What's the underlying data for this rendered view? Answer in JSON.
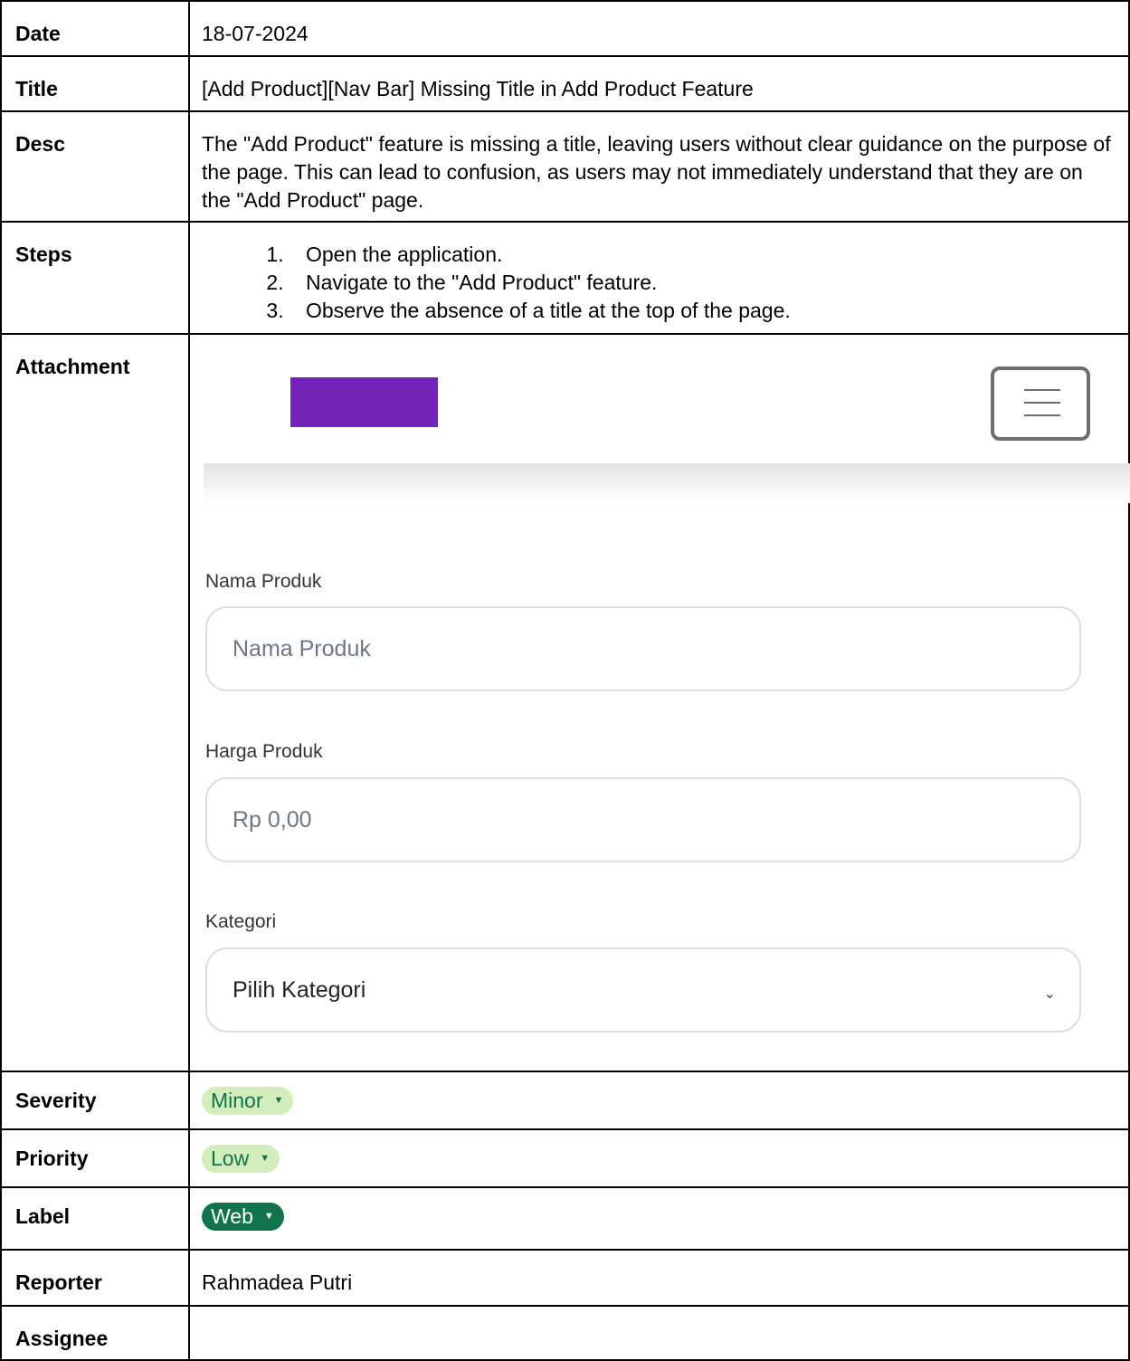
{
  "rows": {
    "date": {
      "label": "Date",
      "value": "18-07-2024"
    },
    "title": {
      "label": "Title",
      "value": "[Add Product][Nav Bar] Missing Title in Add Product Feature"
    },
    "desc": {
      "label": "Desc",
      "value": "The \"Add Product\" feature is missing a title, leaving users without clear guidance on the purpose of the page. This can lead to confusion, as users may not immediately understand that they are on the \"Add Product\" page."
    },
    "steps": {
      "label": "Steps",
      "items": [
        "Open the application.",
        "Navigate to the \"Add Product\" feature.",
        "Observe the absence of a title at the top of the page."
      ]
    },
    "attachment": {
      "label": "Attachment"
    },
    "severity": {
      "label": "Severity",
      "value": "Minor"
    },
    "priority": {
      "label": "Priority",
      "value": "Low"
    },
    "label": {
      "label": "Label",
      "value": "Web"
    },
    "reporter": {
      "label": "Reporter",
      "value": "Rahmadea Putri"
    },
    "assignee": {
      "label": "Assignee",
      "value": ""
    }
  },
  "attachment": {
    "logo_color": "#7124b5",
    "menu_icon": "hamburger-menu-icon",
    "form": {
      "name_label": "Nama Produk",
      "name_placeholder": "Nama Produk",
      "price_label": "Harga Produk",
      "price_placeholder": "Rp 0,00",
      "category_label": "Kategori",
      "category_value": "Pilih Kategori"
    }
  },
  "chip_colors": {
    "light_bg": "#d4edbc",
    "light_text": "#11734b",
    "dark_bg": "#11734b",
    "dark_text": "#ffffff"
  }
}
